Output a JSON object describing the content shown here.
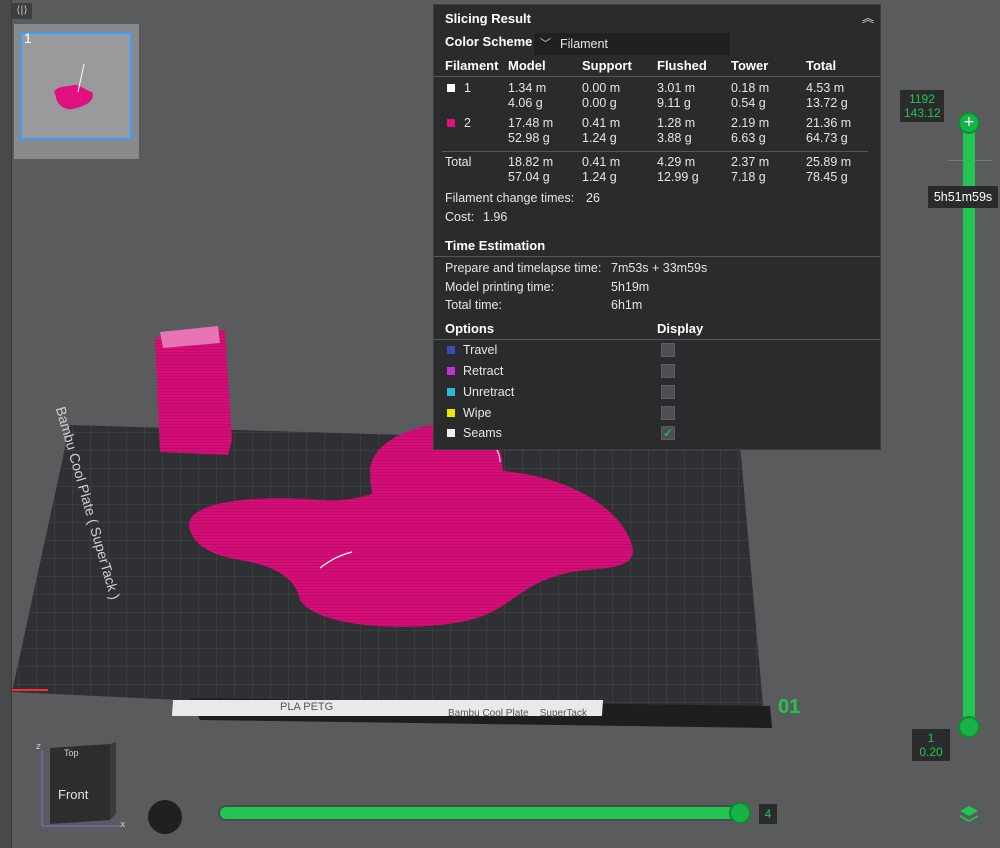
{
  "plate": {
    "number": "1"
  },
  "panel": {
    "title": "Slicing Result",
    "color_scheme_label": "Color Scheme",
    "color_scheme_value": "Filament",
    "columns": [
      "Filament",
      "Model",
      "Support",
      "Flushed",
      "Tower",
      "Total"
    ],
    "rows": [
      {
        "id": "1",
        "color": "#ffffff",
        "model": [
          "1.34 m",
          "4.06 g"
        ],
        "support": [
          "0.00 m",
          "0.00 g"
        ],
        "flushed": [
          "3.01 m",
          "9.11 g"
        ],
        "tower": [
          "0.18 m",
          "0.54 g"
        ],
        "total": [
          "4.53 m",
          "13.72 g"
        ]
      },
      {
        "id": "2",
        "color": "#e0117f",
        "model": [
          "17.48 m",
          "52.98 g"
        ],
        "support": [
          "0.41 m",
          "1.24 g"
        ],
        "flushed": [
          "1.28 m",
          "3.88 g"
        ],
        "tower": [
          "2.19 m",
          "6.63 g"
        ],
        "total": [
          "21.36 m",
          "64.73 g"
        ]
      }
    ],
    "totals": {
      "label": "Total",
      "model": [
        "18.82 m",
        "57.04 g"
      ],
      "support": [
        "0.41 m",
        "1.24 g"
      ],
      "flushed": [
        "4.29 m",
        "12.99 g"
      ],
      "tower": [
        "2.37 m",
        "7.18 g"
      ],
      "total": [
        "25.89 m",
        "78.45 g"
      ]
    },
    "filament_change_label": "Filament change times:",
    "filament_change_value": "26",
    "cost_label": "Cost:",
    "cost_value": "1.96",
    "time_section": "Time Estimation",
    "prepare_label": "Prepare and timelapse time:",
    "prepare_value": "7m53s + 33m59s",
    "model_time_label": "Model printing time:",
    "model_time_value": "5h19m",
    "total_time_label": "Total time:",
    "total_time_value": "6h1m",
    "options_label": "Options",
    "display_label": "Display",
    "options": [
      {
        "label": "Travel",
        "color": "#3b4bb8",
        "checked": false
      },
      {
        "label": "Retract",
        "color": "#c42fd8",
        "checked": false
      },
      {
        "label": "Unretract",
        "color": "#2bb7d4",
        "checked": false
      },
      {
        "label": "Wipe",
        "color": "#f2e600",
        "checked": false
      },
      {
        "label": "Seams",
        "color": "#f0f0f0",
        "checked": true
      }
    ]
  },
  "vslider": {
    "top_layer": "1192",
    "top_height": "143.12",
    "bottom_layer": "1",
    "bottom_height": "0.20",
    "time_tip": "5h51m59s"
  },
  "hslider": {
    "value": "4"
  },
  "bed": {
    "label_main": "Bambu Cool Plate ( SuperTack )",
    "plate_number": "01",
    "strip_text_left": "PLA PETG",
    "strip_text_right": "Bambu Cool Plate    SuperTack"
  },
  "cube": {
    "face": "Front",
    "top": "Top"
  },
  "colors": {
    "accent": "#23c552",
    "filament2": "#e0117f",
    "panel_bg": "#2a2b2d"
  }
}
